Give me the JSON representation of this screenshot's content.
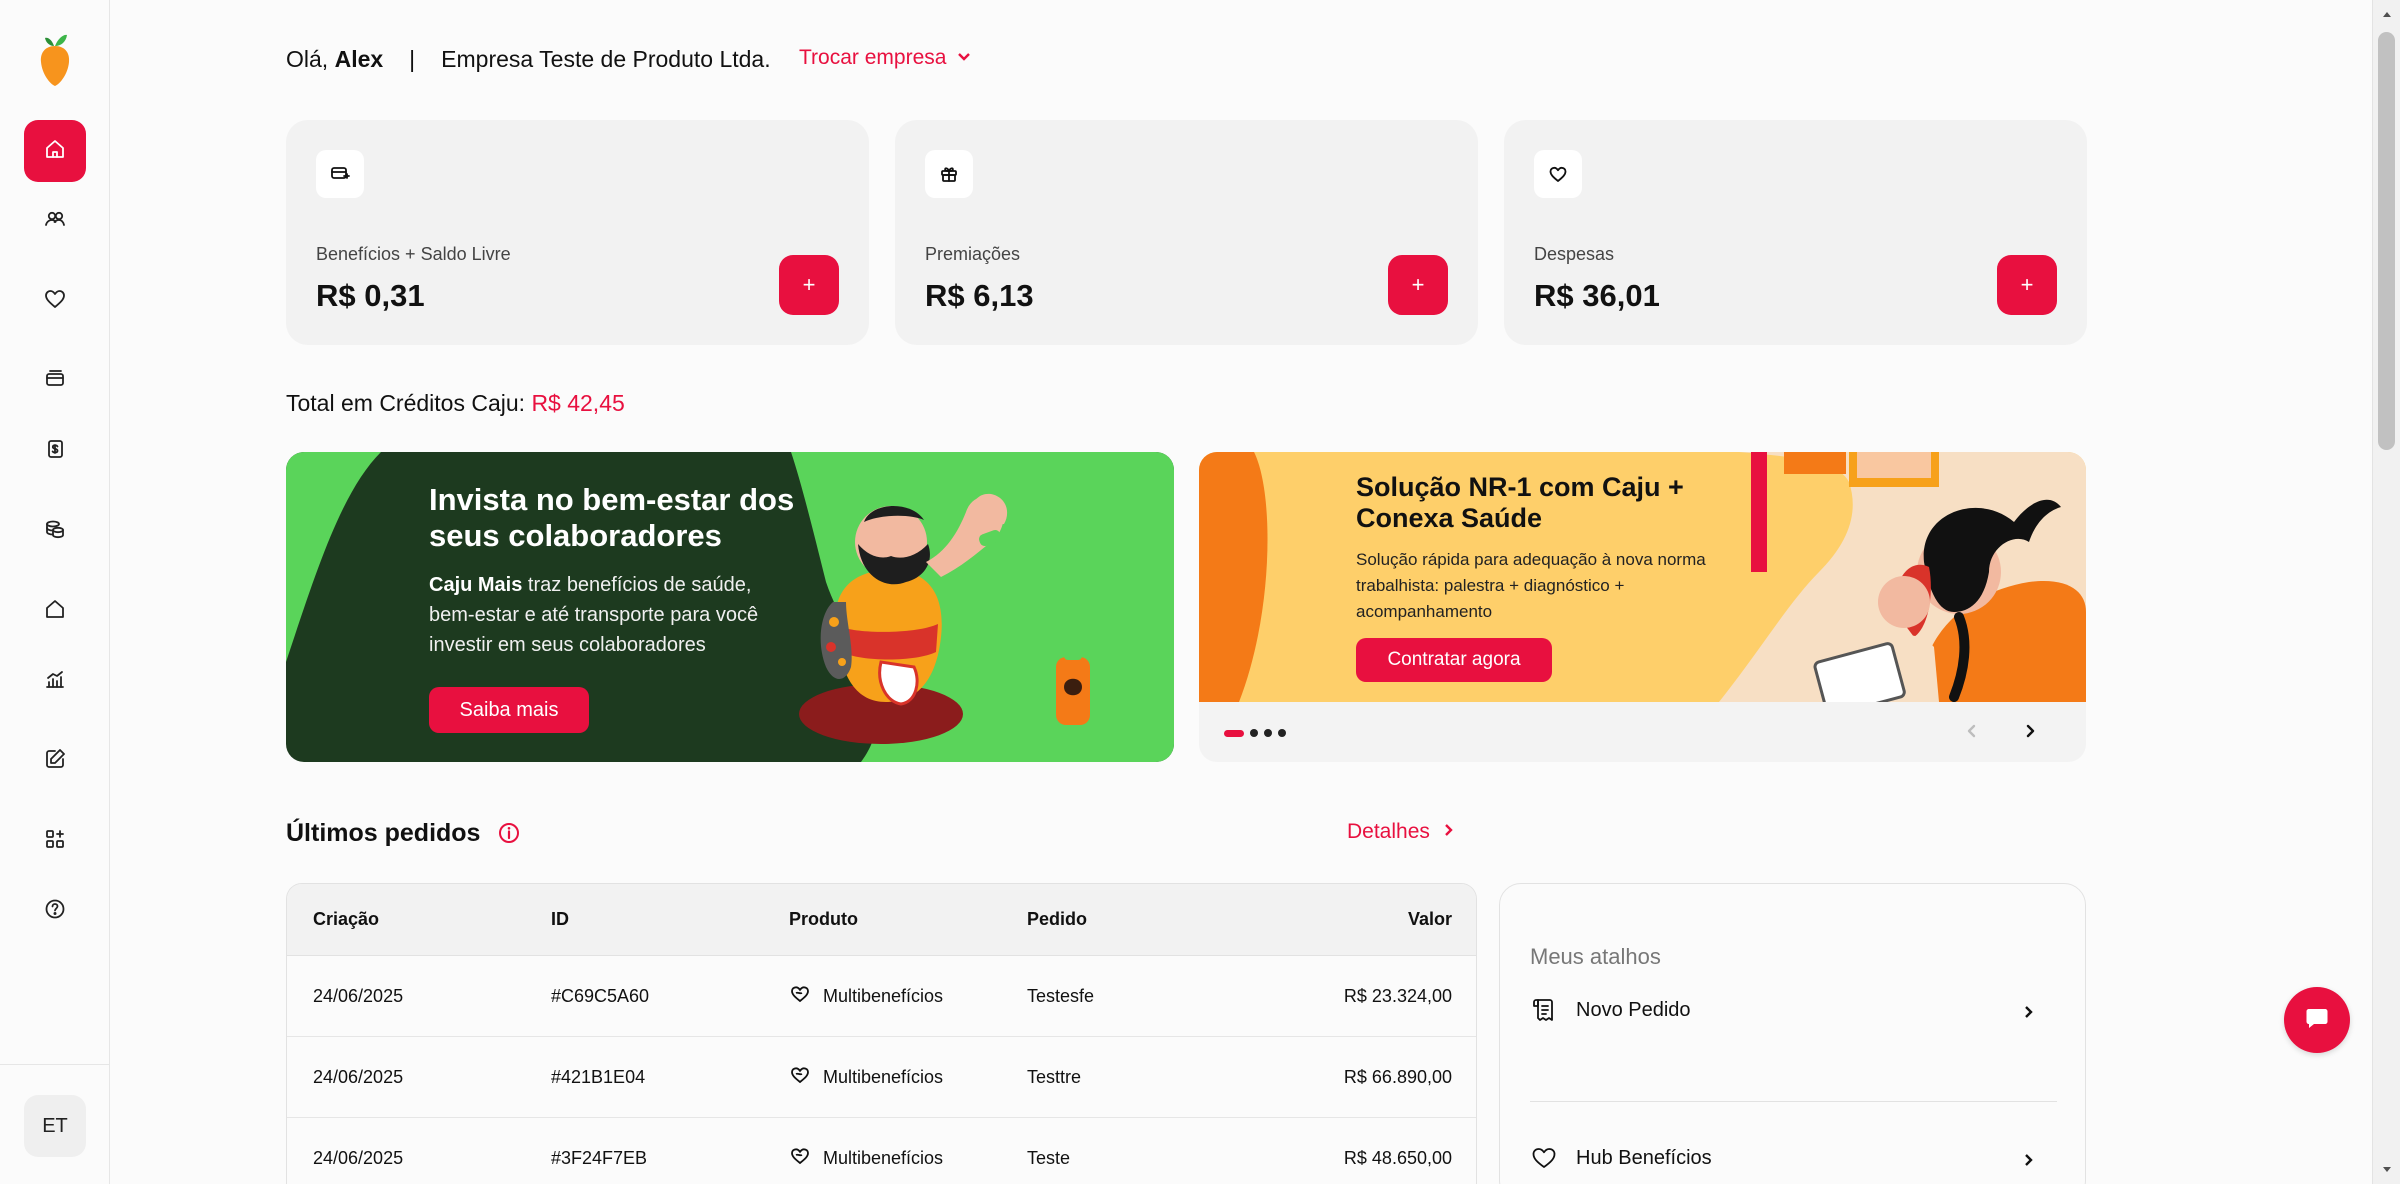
{
  "sidebar": {
    "logo": "caju-logo",
    "items": [
      {
        "name": "home-icon",
        "active": true
      },
      {
        "name": "users-icon"
      },
      {
        "name": "heart-icon"
      },
      {
        "name": "card-icon"
      },
      {
        "name": "receipt-icon"
      },
      {
        "name": "coins-icon"
      },
      {
        "name": "house-icon"
      },
      {
        "name": "chart-icon"
      },
      {
        "name": "edit-icon"
      },
      {
        "name": "apps-icon"
      },
      {
        "name": "help-icon"
      }
    ],
    "avatar_initials": "ET"
  },
  "header": {
    "greeting_prefix": "Olá,",
    "user_name": "Alex",
    "separator": "|",
    "company": "Empresa Teste de Produto Ltda.",
    "switch_label": "Trocar empresa"
  },
  "cards": [
    {
      "label": "Benefícios + Saldo Livre",
      "amount": "R$ 0,31",
      "icon": "wallet-icon",
      "button": "+"
    },
    {
      "label": "Premiações",
      "amount": "R$ 6,13",
      "icon": "gift-icon",
      "button": "+"
    },
    {
      "label": "Despesas",
      "amount": "R$ 36,01",
      "icon": "heart-icon",
      "button": "+"
    }
  ],
  "total": {
    "label": "Total em Créditos Caju:",
    "value": "R$ 42,45"
  },
  "banner1": {
    "title": "Invista no bem-estar dos seus colaboradores",
    "text_bold": "Caju Mais",
    "text_rest": " traz benefícios de saúde, bem-estar e até transporte para você investir em seus colaboradores",
    "button": "Saiba mais"
  },
  "banner2": {
    "title": "Solução NR-1 com Caju + Conexa Saúde",
    "text": "Solução rápida para adequação à nova norma trabalhista: palestra + diagnóstico + acompanhamento",
    "button": "Contratar agora",
    "slides_total": 4,
    "active_slide": 1
  },
  "orders": {
    "title": "Últimos pedidos",
    "details_label": "Detalhes",
    "columns": [
      "Criação",
      "ID",
      "Produto",
      "Pedido",
      "Valor"
    ],
    "rows": [
      {
        "date": "24/06/2025",
        "id": "#C69C5A60",
        "product": "Multibenefícios",
        "order": "Testesfe",
        "value": "R$ 23.324,00"
      },
      {
        "date": "24/06/2025",
        "id": "#421B1E04",
        "product": "Multibenefícios",
        "order": "Testtre",
        "value": "R$ 66.890,00"
      },
      {
        "date": "24/06/2025",
        "id": "#3F24F7EB",
        "product": "Multibenefícios",
        "order": "Teste",
        "value": "R$ 48.650,00"
      }
    ]
  },
  "shortcuts": {
    "title": "Meus atalhos",
    "items": [
      {
        "label": "Novo Pedido",
        "icon": "document-icon"
      },
      {
        "label": "Hub Benefícios",
        "icon": "heart-icon"
      }
    ]
  },
  "colors": {
    "accent": "#e8103f",
    "banner1_bg": "#1d3a1f",
    "banner1_green": "#5ad45a",
    "banner2_yellow": "#fecf6a",
    "banner2_orange": "#f47a17"
  }
}
